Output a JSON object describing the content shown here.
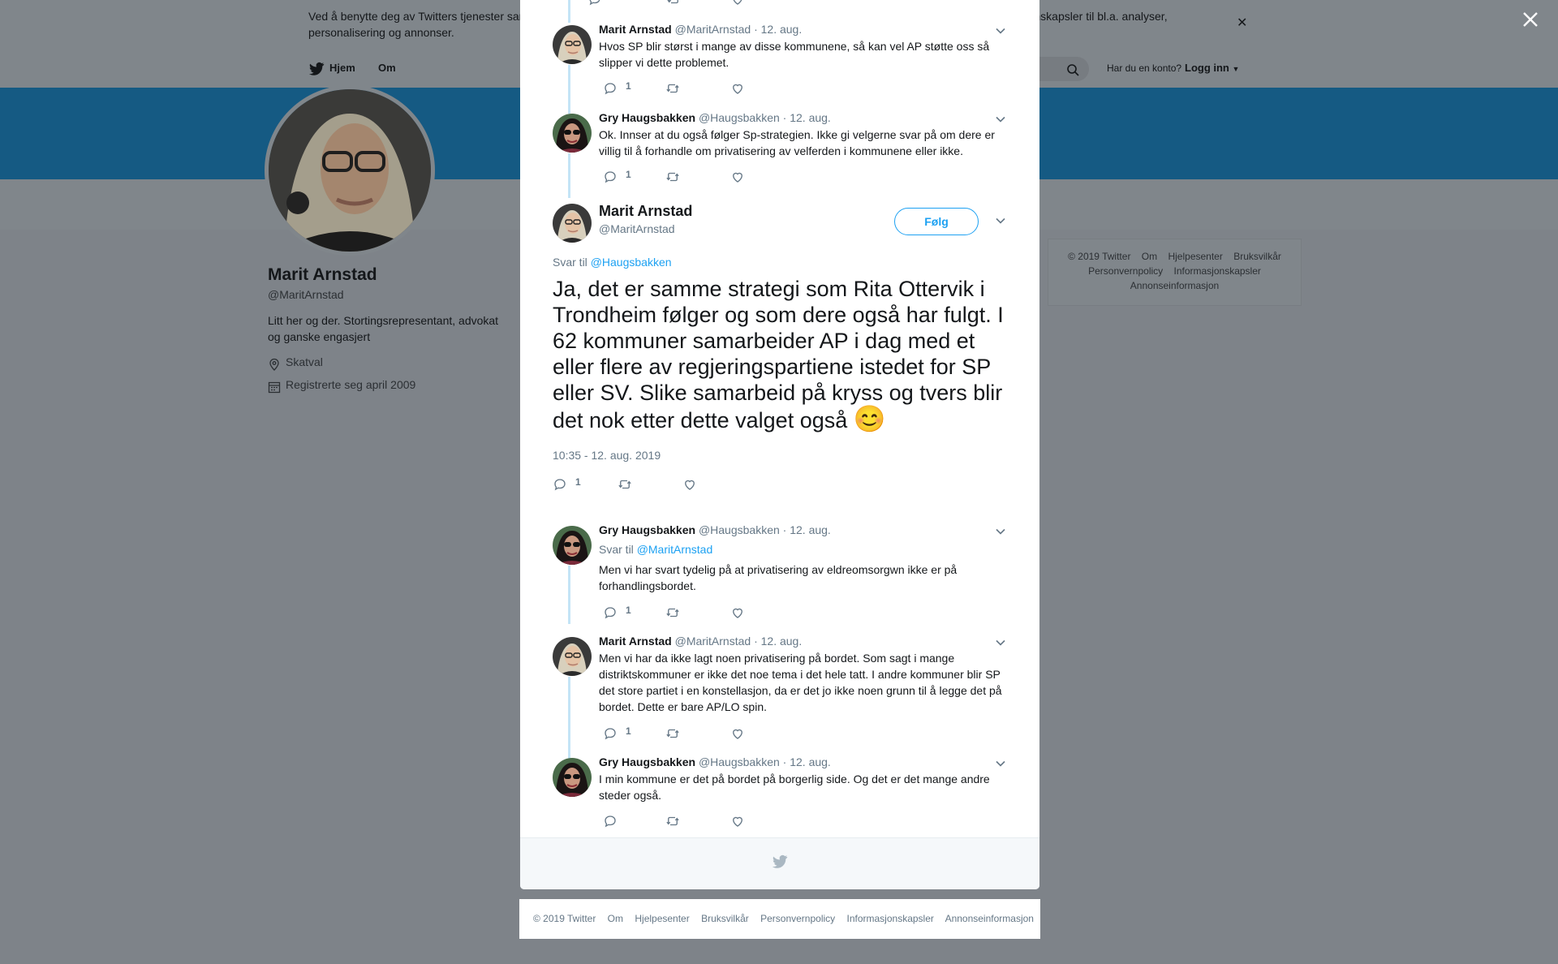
{
  "cookie": {
    "text": "Ved å benytte deg av Twitters tjenester samtykker du i vår bruk av informasjonskapsler. Vi og våre partnere arbeider globalt og bruker informasjonskapsler til bl.a. analyser, personalisering og annonser."
  },
  "nav": {
    "home": "Hjem",
    "about": "Om",
    "login_question": "Har du en konto?",
    "login": "Logg inn"
  },
  "profile": {
    "name": "Marit Arnstad",
    "handle": "@MaritArnstad",
    "bio": "Litt her og der. Stortingsrepresentant, advokat og ganske engasjert",
    "location": "Skatval",
    "joined": "Registrerte seg april 2009"
  },
  "side_footer": [
    "© 2019 Twitter",
    "Om",
    "Hjelpesenter",
    "Bruksvilkår",
    "Personvernpolicy",
    "Informasjonskapsler",
    "Annonseinformasjon"
  ],
  "thread_top": [
    {
      "name": "Marit Arnstad",
      "handle": "@MaritArnstad",
      "date": "· 12. aug.",
      "text": "Hvos SP blir størst i mange av disse kommunene, så kan vel AP støtte oss så slipper vi dette problemet.",
      "replies": "1"
    },
    {
      "name": "Gry Haugsbakken",
      "handle": "@Haugsbakken",
      "date": "· 12. aug.",
      "text": "Ok. Innser at du også følger Sp-strategien. Ikke gi velgerne svar på om dere er villig til å forhandle om privatisering av velferden i kommunene eller ikke.",
      "replies": "1"
    }
  ],
  "top_partial_replies": "2",
  "main": {
    "name": "Marit Arnstad",
    "handle": "@MaritArnstad",
    "follow": "Følg",
    "reply_prefix": "Svar til",
    "reply_handle": "@Haugsbakken",
    "text": "Ja, det er samme strategi som Rita Ottervik i Trondheim følger og som dere også har fulgt. I 62 kommuner samarbeider AP i dag med et eller flere av regjeringspartiene istedet for SP eller SV. Slike samarbeid på kryss og tvers blir det nok etter dette valget også",
    "emoji": "😊",
    "time": "10:35 - 12. aug. 2019",
    "replies": "1"
  },
  "thread_bottom": [
    {
      "name": "Gry Haugsbakken",
      "handle": "@Haugsbakken",
      "date": "· 12. aug.",
      "reply_prefix": "Svar til",
      "reply_handle": "@MaritArnstad",
      "text": "Men vi har svart tydelig på at privatisering av eldreomsorgwn ikke er på forhandlingsbordet.",
      "replies": "1"
    },
    {
      "name": "Marit Arnstad",
      "handle": "@MaritArnstad",
      "date": "· 12. aug.",
      "text": "Men vi har da ikke lagt noen privatisering på bordet. Som sagt i mange distriktskommuner er ikke det noe tema i det hele tatt. I andre kommuner blir SP det store partiet i en konstellasjon,  da er det jo ikke noen grunn til å legge det på bordet. Dette er bare AP/LO spin.",
      "replies": "1"
    },
    {
      "name": "Gry Haugsbakken",
      "handle": "@Haugsbakken",
      "date": "· 12. aug.",
      "text": "I min kommune er det på bordet på borgerlig side. Og det er det mange andre steder også.",
      "replies": ""
    }
  ],
  "page_footer": [
    "© 2019 Twitter",
    "Om",
    "Hjelpesenter",
    "Bruksvilkår",
    "Personvernpolicy",
    "Informasjonskapsler",
    "Annonseinformasjon"
  ],
  "colors": {
    "link": "#1da1f2",
    "thread_line": "#c4e4f6",
    "overlay": "#7e8389",
    "muted": "#657786"
  }
}
